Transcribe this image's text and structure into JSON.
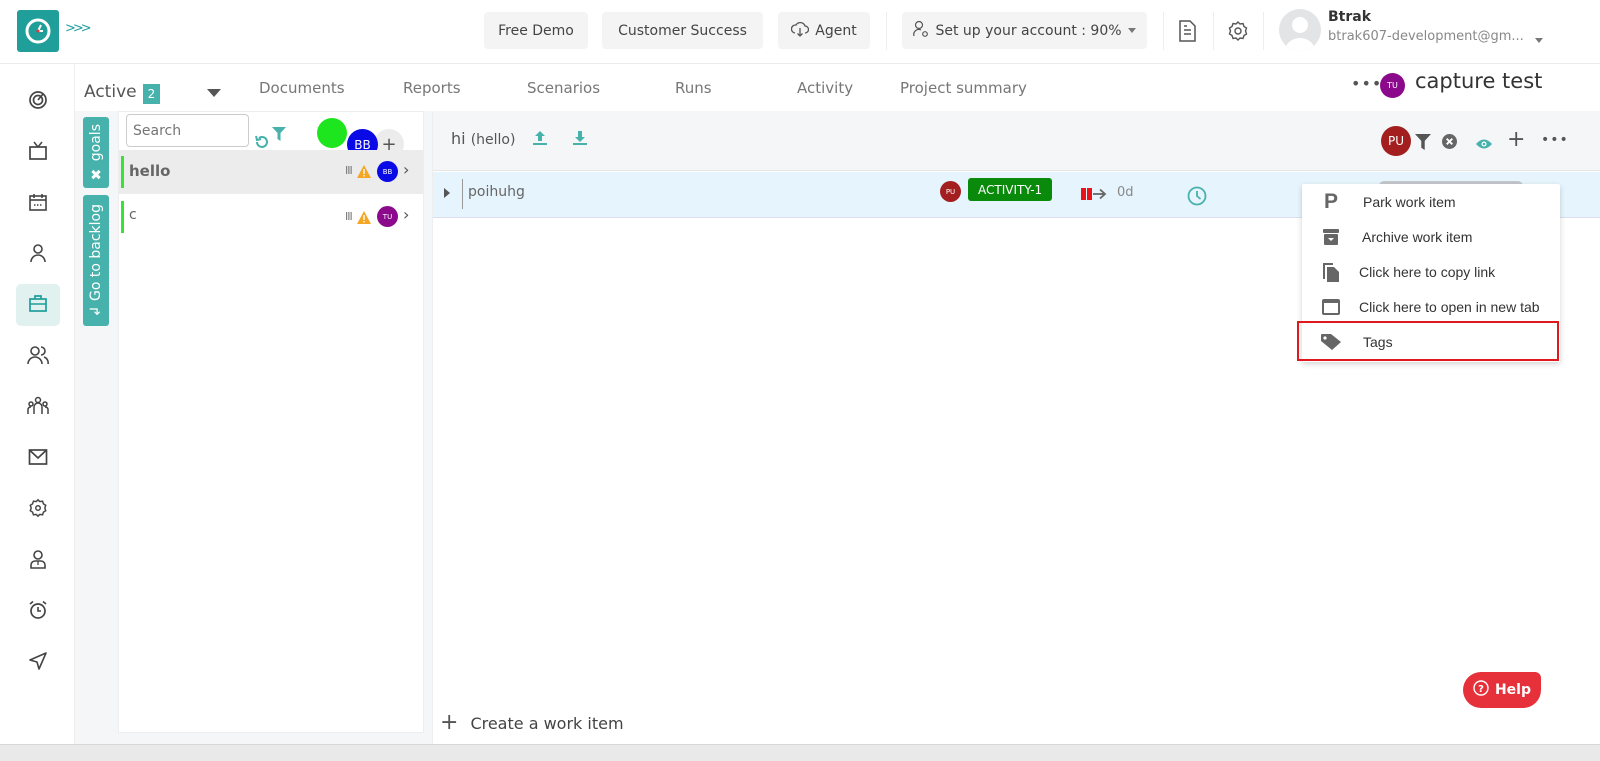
{
  "header": {
    "logo": "timer-logo-icon",
    "expand_icon": ">>>",
    "buttons": [
      {
        "label": "Free Demo"
      },
      {
        "label": "Customer Success"
      },
      {
        "label": "Agent",
        "icon": "cloud-download-icon"
      },
      {
        "label": "Set up your account : 90%",
        "icon": "user-settings-icon",
        "progress_percent": 90
      }
    ],
    "user": {
      "name": "Btrak",
      "email": "btrak607-development@gm..."
    }
  },
  "sidebar": {
    "items": [
      {
        "name": "dashboard",
        "icon": "target-icon"
      },
      {
        "name": "tv",
        "icon": "tv-icon"
      },
      {
        "name": "calendar",
        "icon": "calendar-icon"
      },
      {
        "name": "user",
        "icon": "user-icon"
      },
      {
        "name": "projects",
        "icon": "briefcase-icon",
        "active": true
      },
      {
        "name": "team",
        "icon": "users-icon"
      },
      {
        "name": "groups",
        "icon": "group-icon"
      },
      {
        "name": "mail",
        "icon": "mail-icon"
      },
      {
        "name": "settings",
        "icon": "gear-icon"
      },
      {
        "name": "profile",
        "icon": "profile-icon"
      },
      {
        "name": "alarm",
        "icon": "alarm-icon"
      },
      {
        "name": "send",
        "icon": "send-icon"
      }
    ]
  },
  "subheader": {
    "status_label": "Active",
    "status_count": "2",
    "tabs": [
      "Documents",
      "Reports",
      "Scenarios",
      "Runs",
      "Activity",
      "Project summary"
    ],
    "more": "•••",
    "project_avatar": "TU",
    "project_name": "capture test"
  },
  "goals": {
    "vertical_tabs": {
      "goals": "goals",
      "backlog": "Go to backlog"
    },
    "search_placeholder": "Search",
    "avatar_bb": "BB",
    "add": "+",
    "items": [
      {
        "name": "hello",
        "avatar": "BB",
        "avatar_color": "#0a0ae6",
        "selected": true
      },
      {
        "name": "c",
        "avatar": "TU",
        "avatar_color": "#8b0a8b",
        "selected": false
      }
    ],
    "priority_glyph": "III"
  },
  "workpanel": {
    "title": "hi",
    "subtitle": "(hello)",
    "toolbar_avatar": "PU",
    "items": [
      {
        "name": "poihuhg",
        "assignee": "PU",
        "badge": "ACTIVITY-1",
        "duration": "0d"
      }
    ],
    "create_label": "Create a work item"
  },
  "context_menu": {
    "items": [
      {
        "label": "Park work item",
        "icon": "park-icon"
      },
      {
        "label": "Archive work item",
        "icon": "archive-icon"
      },
      {
        "label": "Click here to copy link",
        "icon": "copy-icon"
      },
      {
        "label": "Click here to open in new tab",
        "icon": "new-tab-icon"
      },
      {
        "label": "Tags",
        "icon": "tag-icon",
        "highlighted": true
      }
    ]
  },
  "help": {
    "label": "Help"
  },
  "colors": {
    "brand": "#1f9e9a",
    "accent": "#47b2ac",
    "badge_green": "#0a8a0a",
    "highlight_red": "#e0191f",
    "help_red": "#e6313b"
  }
}
